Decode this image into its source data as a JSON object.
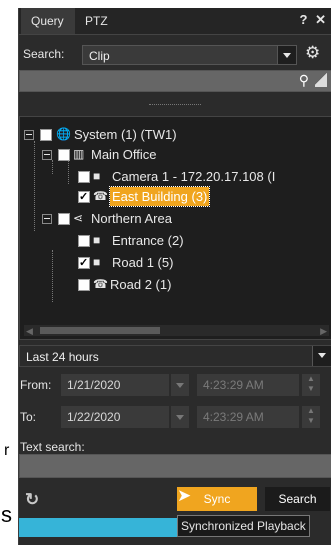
{
  "tabs": [
    "Query",
    "PTZ"
  ],
  "window_buttons": {
    "help": "?",
    "close": "✕"
  },
  "search": {
    "label": "Search:",
    "value": "Clip"
  },
  "tree": {
    "system": "System (1) (TW1)",
    "main_office": "Main Office",
    "camera1": "Camera 1 - 172.20.17.108 (I",
    "east_building": "East Building (3)",
    "northern_area": "Northern Area",
    "entrance": "Entrance (2)",
    "road1": "Road 1 (5)",
    "road2": "Road 2 (1)"
  },
  "time_range": "Last 24 hours",
  "from": {
    "label": "From:",
    "date": "1/21/2020",
    "time": "4:23:29 AM"
  },
  "to": {
    "label": "To:",
    "date": "1/22/2020",
    "time": "4:23:29 AM"
  },
  "text_search": {
    "label": "Text search:",
    "value": ""
  },
  "buttons": {
    "sync": "Sync",
    "search": "Search"
  },
  "tooltip": "Synchronized Playback",
  "side_fragments": {
    "top": "r",
    "bottom": "s"
  },
  "colors": {
    "accent": "#f0a51f",
    "panel": "#2b2b2b",
    "tree_bg": "#1e1e1e",
    "taskbar": "#36b4d8"
  },
  "icons": {
    "settings": "gear-icon",
    "search": "search-icon",
    "clear": "eraser-icon",
    "refresh": "refresh-icon"
  }
}
